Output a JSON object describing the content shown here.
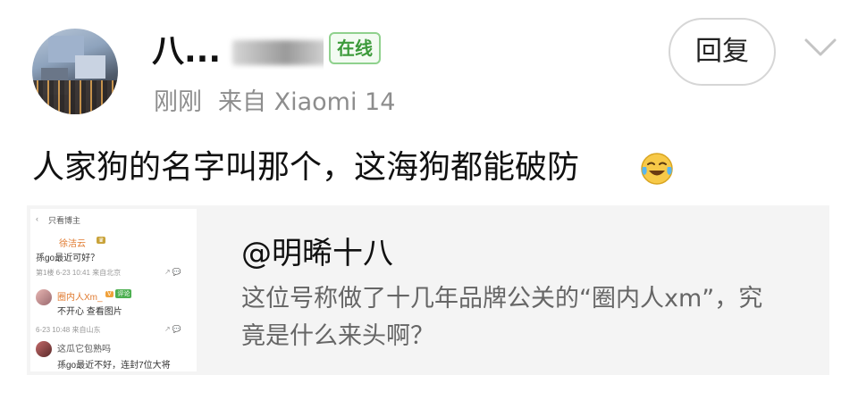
{
  "post": {
    "username": "八...",
    "online_badge": "在线",
    "time": "刚刚",
    "source": "来自 Xiaomi 14",
    "reply_label": "回复",
    "text": "人家狗的名字叫那个，这海狗都能破防",
    "emoji_icon": "laughing-crying-icon"
  },
  "quote_card": {
    "title": "@明晞十八",
    "desc_line1": "这位号称做了十几年品牌公关的“圈内人xm”，究",
    "desc_line2": "竟是什么来头啊？",
    "thumb": {
      "header": "只看博主",
      "c1_name": "徐洁云",
      "c1_text": "孫go最近可好？",
      "c1_meta": "第1楼 6-23 10:41 来自北京",
      "c2_name": "圈内人Xm_",
      "c2_text": "不开心  查看图片",
      "c2_meta": "6-23 10:48 来自山东",
      "c3_name": "这瓜它包熟吗",
      "c3_text": "孫go最近不好，连封7位大将"
    }
  },
  "colors": {
    "badge_green": "#3c9a3a",
    "meta_gray": "#8d8d8d",
    "card_bg": "#f4f4f4"
  }
}
